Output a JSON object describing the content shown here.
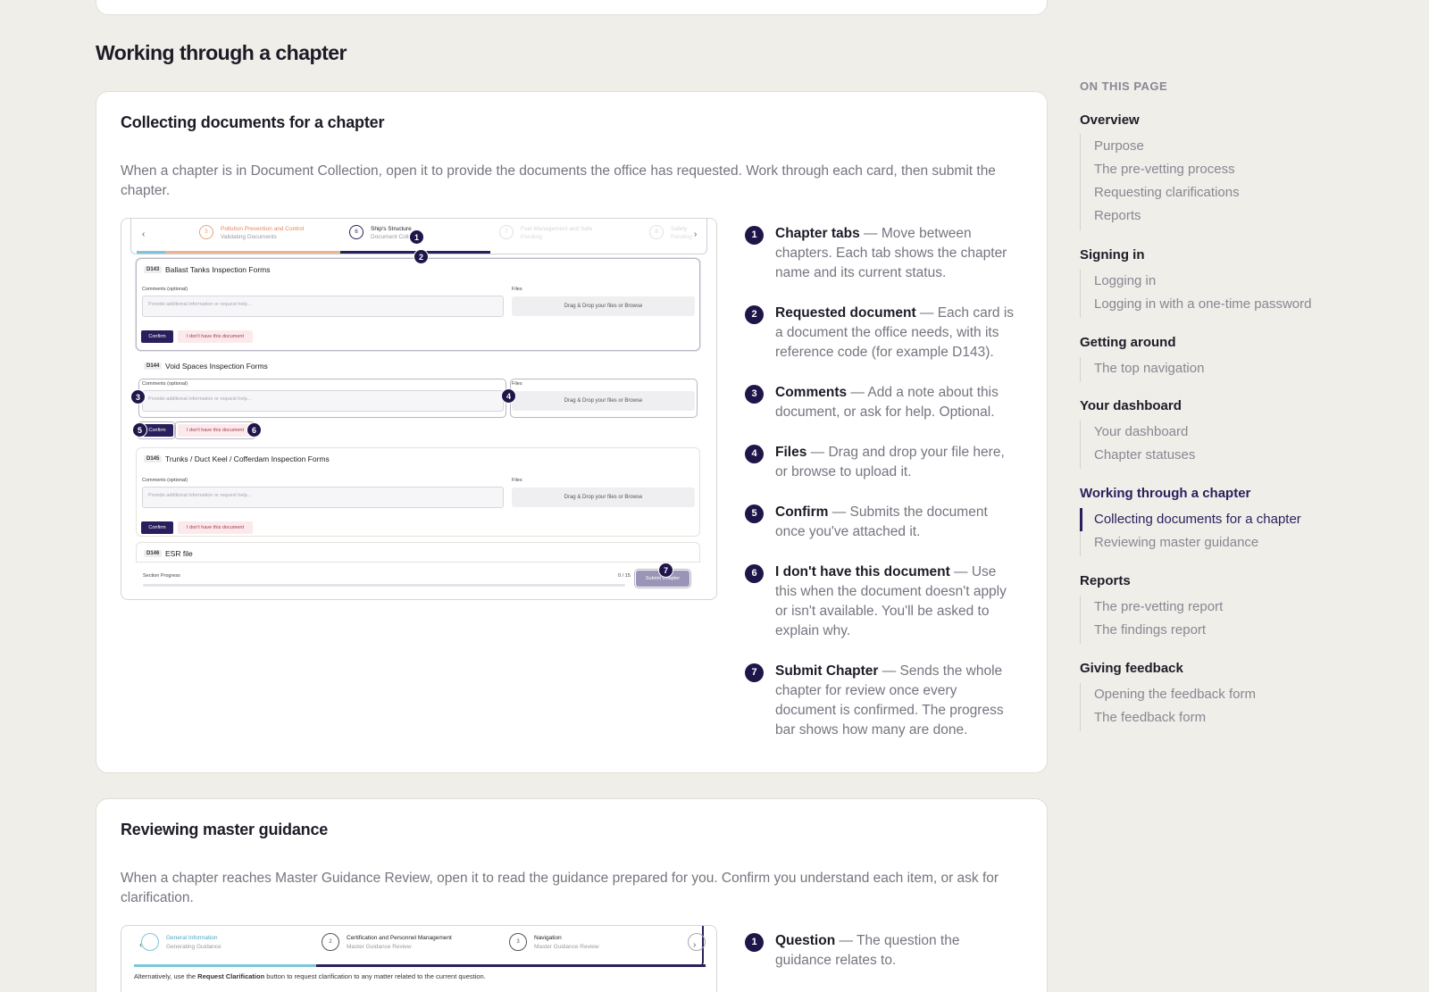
{
  "section_title": "Working through a chapter",
  "collecting": {
    "title": "Collecting documents for a chapter",
    "intro": "When a chapter is in Document Collection, open it to provide the documents the office has requested. Work through each card, then submit the chapter.",
    "mock": {
      "tabs": [
        {
          "num": "5",
          "name": "Pollution Prevention and Control",
          "status": "Validating Documents"
        },
        {
          "num": "6",
          "name": "Ship's Structure",
          "status": "Document Colle..."
        },
        {
          "num": "7",
          "name": "Fuel Management and Safe",
          "status": "Pending"
        },
        {
          "num": "8",
          "name": "Safety",
          "status": "Pending"
        }
      ],
      "comments_label": "Comments  (optional)",
      "files_label": "Files",
      "comment_placeholder": "Provide additional information or request help...",
      "files_hint": "Drag & Drop your files or Browse",
      "confirm_label": "Confirm",
      "nodoc_label": "I don't have this document",
      "cards": [
        {
          "code": "D143",
          "title": "Ballast Tanks Inspection Forms"
        },
        {
          "code": "D144",
          "title": "Void Spaces Inspection Forms"
        },
        {
          "code": "D145",
          "title": "Trunks / Duct Keel / Cofferdam Inspection Forms"
        },
        {
          "code": "D146",
          "title": "ESR file"
        }
      ],
      "progress_label": "Section Progress",
      "progress_count": "0 / 15",
      "submit_label": "Submit Chapter"
    },
    "legend": [
      {
        "num": "1",
        "term": "Chapter tabs",
        "desc": " — Move between chapters. Each tab shows the chapter name and its current status."
      },
      {
        "num": "2",
        "term": "Requested document",
        "desc": " — Each card is a document the office needs, with its reference code (for example D143)."
      },
      {
        "num": "3",
        "term": "Comments",
        "desc": " — Add a note about this document, or ask for help. Optional."
      },
      {
        "num": "4",
        "term": "Files",
        "desc": " — Drag and drop your file here, or browse to upload it."
      },
      {
        "num": "5",
        "term": "Confirm",
        "desc": " — Submits the document once you've attached it."
      },
      {
        "num": "6",
        "term": "I don't have this document",
        "desc": " — Use this when the document doesn't apply or isn't available. You'll be asked to explain why."
      },
      {
        "num": "7",
        "term": "Submit Chapter",
        "desc": " — Sends the whole chapter for review once every document is confirmed. The progress bar shows how many are done."
      }
    ]
  },
  "reviewing": {
    "title": "Reviewing master guidance",
    "intro": "When a chapter reaches Master Guidance Review, open it to read the guidance prepared for you. Confirm you understand each item, or ask for clarification.",
    "mock": {
      "tabs": [
        {
          "num": "1",
          "name": "General Information",
          "status": "Generating Guidance"
        },
        {
          "num": "2",
          "name": "Certification and Personnel Management",
          "status": "Master Guidance Review"
        },
        {
          "num": "3",
          "name": "Navigation",
          "status": "Master Guidance Review"
        },
        {
          "num": "4",
          "name": "",
          "status": ""
        }
      ],
      "note_prefix": "Alternatively, use the ",
      "note_bold": "Request Clarification",
      "note_suffix": " button to request clarification to any matter related to the current question."
    },
    "legend": [
      {
        "num": "1",
        "term": "Question",
        "desc": " — The question the guidance relates to."
      }
    ]
  },
  "toc": {
    "heading": "ON THIS PAGE",
    "groups": [
      {
        "label": "Overview",
        "links": [
          "Purpose",
          "The pre-vetting process",
          "Requesting clarifications",
          "Reports"
        ]
      },
      {
        "label": "Signing in",
        "links": [
          "Logging in",
          "Logging in with a one-time password"
        ]
      },
      {
        "label": "Getting around",
        "links": [
          "The top navigation"
        ]
      },
      {
        "label": "Your dashboard",
        "links": [
          "Your dashboard",
          "Chapter statuses"
        ]
      },
      {
        "label": "Working through a chapter",
        "links": [
          "Collecting documents for a chapter",
          "Reviewing master guidance"
        ]
      },
      {
        "label": "Reports",
        "links": [
          "The pre-vetting report",
          "The findings report"
        ]
      },
      {
        "label": "Giving feedback",
        "links": [
          "Opening the feedback form",
          "The feedback form"
        ]
      }
    ]
  },
  "colors": {
    "accent": "#2a1f5c",
    "muted": "#77747f",
    "background": "#efeee9"
  }
}
